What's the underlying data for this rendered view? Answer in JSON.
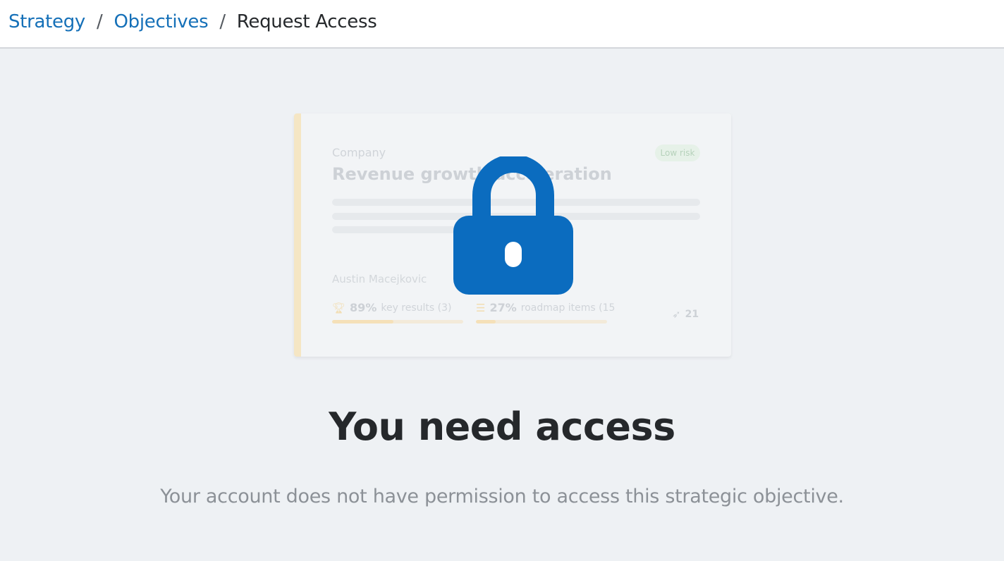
{
  "breadcrumb": {
    "items": [
      {
        "label": "Strategy"
      },
      {
        "label": "Objectives"
      }
    ],
    "separator": "/",
    "current": "Request Access"
  },
  "preview_card": {
    "category": "Company",
    "title": "Revenue growth acceleration",
    "risk_badge": "Low risk",
    "owner": "Austin Macejkovic",
    "key_results": {
      "percent": "89%",
      "label": "key results (3)",
      "progress": 0.47
    },
    "roadmap": {
      "percent": "27%",
      "label": "roadmap items (15",
      "progress": 0.15
    },
    "count": "21",
    "icons": [
      "trophy-icon",
      "list-icon",
      "rocket-icon",
      "lock-icon"
    ]
  },
  "message": {
    "heading": "You need access",
    "body": "Your account does not have permission to access this strategic objective."
  },
  "colors": {
    "link": "#1570b8",
    "lock": "#0b6cbf",
    "background": "#eef1f4",
    "accent_bar": "#f5e6c4"
  }
}
